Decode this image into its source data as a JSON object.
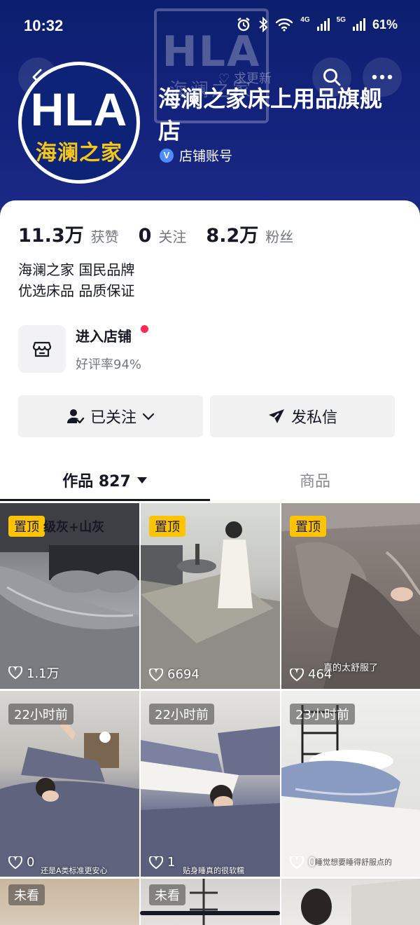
{
  "status_bar": {
    "time": "10:32",
    "network_a": "4G",
    "network_b": "5G",
    "battery": "61%"
  },
  "header": {
    "watermark_text": "HLA",
    "watermark_sub": "海澜之家",
    "refresh_hint": "求更新",
    "avatar_logo": "HLA",
    "avatar_cn": "海澜之家",
    "shop_name": "海澜之家床上用品旗舰店",
    "account_type": "店铺账号",
    "icons": [
      "back-icon",
      "search-icon",
      "more-icon",
      "verified-icon"
    ]
  },
  "stats": [
    {
      "value": "11.3万",
      "label": "获赞"
    },
    {
      "value": "0",
      "label": "关注"
    },
    {
      "value": "8.2万",
      "label": "粉丝"
    }
  ],
  "bio": {
    "line1": "海澜之家 国民品牌",
    "line2": "优选床品 品质保证"
  },
  "shop_entry": {
    "title": "进入店铺",
    "rating": "好评率94%",
    "has_dot": true
  },
  "buttons": {
    "follow_label": "已关注",
    "message_label": "发私信"
  },
  "tabs": {
    "works_label": "作品 827",
    "goods_label": "商品"
  },
  "videos": [
    {
      "tag": "置顶",
      "tag_type": "pin",
      "likes": "1.1万",
      "caption": "级灰+山灰",
      "caption2": ""
    },
    {
      "tag": "置顶",
      "tag_type": "pin",
      "likes": "6694",
      "caption": "",
      "caption2": ""
    },
    {
      "tag": "置顶",
      "tag_type": "pin",
      "likes": "464",
      "caption": "真的太舒服了",
      "caption2": ""
    },
    {
      "tag": "22小时前",
      "tag_type": "time",
      "likes": "0",
      "caption": "还是A类标准更安心",
      "caption2": ""
    },
    {
      "tag": "22小时前",
      "tag_type": "time",
      "likes": "1",
      "caption": "贴身睡真的很软糯",
      "caption2": ""
    },
    {
      "tag": "23小时前",
      "tag_type": "time",
      "likes": "0",
      "caption": "睡觉想要睡得舒服点的",
      "caption2": ""
    },
    {
      "tag": "未看",
      "tag_type": "time",
      "likes": "",
      "caption": "",
      "caption2": ""
    },
    {
      "tag": "未看",
      "tag_type": "time",
      "likes": "",
      "caption": "",
      "caption2": ""
    },
    {
      "tag": "",
      "tag_type": "none",
      "likes": "",
      "caption": "",
      "caption2": ""
    }
  ],
  "colors": {
    "banner": "#12227a",
    "pin": "#ffc300",
    "notify_dot": "#fe2c55",
    "button_bg": "#f1f1f2",
    "text_primary": "#161823",
    "text_secondary": "#757780"
  }
}
